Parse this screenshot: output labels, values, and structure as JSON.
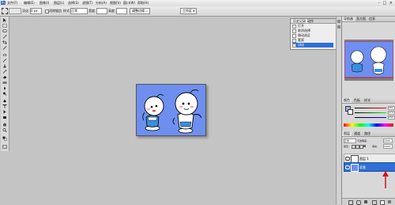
{
  "app": {
    "ps_logo": "Ps",
    "menus": [
      "文件(F)",
      "编辑(E)",
      "图像(I)",
      "图层(L)",
      "选择(S)",
      "滤镜(T)",
      "分析(A)",
      "视图(V)",
      "窗口(W)",
      "帮助(H)"
    ],
    "window_controls": "– □ ×"
  },
  "options": {
    "feather_label": "羽化:",
    "feather_value": "0 px",
    "antialias_label": "消除锯齿",
    "style_label": "样式:",
    "style_value": "正常",
    "width_label": "宽度:",
    "height_label": "高度:",
    "refine_label": "调整边缘...",
    "workspace_label": "工作区 ▾"
  },
  "history": {
    "tabs": [
      "历史记录",
      "动作"
    ],
    "items": [
      "打开",
      "取消选择",
      "移动选区",
      "套索",
      "羽化"
    ],
    "selected_index": 4
  },
  "navigator": {
    "tabs": [
      "导航器",
      "直方图",
      "信息"
    ]
  },
  "color": {
    "tabs": [
      "颜色",
      "色板",
      "样式"
    ],
    "r": "167",
    "g": "174",
    "b": "232"
  },
  "layers": {
    "tabs": [
      "图层",
      "通道",
      "路径"
    ],
    "blend_mode": "正常",
    "opacity_label": "不透明度:",
    "opacity_value": "100%",
    "lock_label": "锁定:",
    "fill_label": "填充:",
    "fill_value": "100%",
    "items": [
      {
        "name": "图层 1",
        "selected": false
      },
      {
        "name": "背景",
        "selected": true
      }
    ]
  },
  "colors": {
    "canvas_bg": "#6e8ff0",
    "selection_blue": "#2f6fd8",
    "annotation_red": "#d8101c",
    "workspace_gray": "#c4c4c4"
  }
}
